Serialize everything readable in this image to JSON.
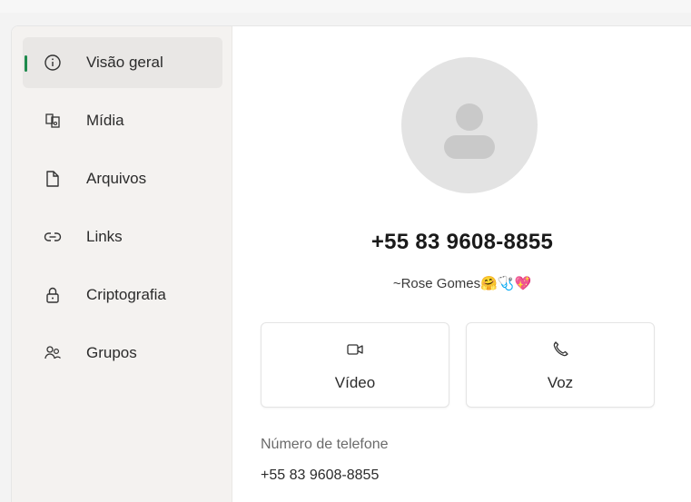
{
  "sidebar": {
    "items": [
      {
        "label": "Visão geral",
        "icon": "info-icon",
        "active": true
      },
      {
        "label": "Mídia",
        "icon": "media-icon",
        "active": false
      },
      {
        "label": "Arquivos",
        "icon": "file-icon",
        "active": false
      },
      {
        "label": "Links",
        "icon": "link-icon",
        "active": false
      },
      {
        "label": "Criptografia",
        "icon": "lock-icon",
        "active": false
      },
      {
        "label": "Grupos",
        "icon": "groups-icon",
        "active": false
      }
    ]
  },
  "contact": {
    "phone": "+55 83 9608-8855",
    "nickname": "~Rose Gomes🤗🩺💖"
  },
  "actions": {
    "video_label": "Vídeo",
    "voice_label": "Voz"
  },
  "details": {
    "phone_label": "Número de telefone",
    "phone_value": "+55 83 9608-8855"
  },
  "colors": {
    "accent": "#1e8a4c",
    "sidebar_bg": "#f4f2f0",
    "avatar_bg": "#e3e3e3"
  }
}
